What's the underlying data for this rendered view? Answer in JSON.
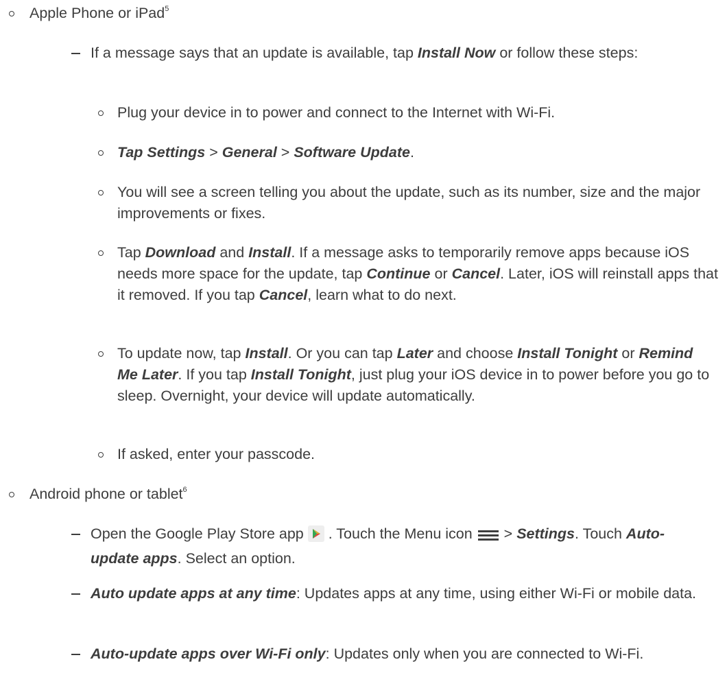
{
  "apple": {
    "heading": "Apple Phone or iPad",
    "footnote": "5",
    "intro": {
      "t1": "If a message says that an update is available, tap ",
      "b1": "Install Now",
      "t2": " or follow these steps:"
    },
    "steps": {
      "s1": "Plug your device in to power and connect to the Internet with Wi-Fi.",
      "s2": {
        "b1": "Tap Settings",
        "t1": " > ",
        "b2": "General",
        "t2": " > ",
        "b3": "Software Update",
        "t3": "."
      },
      "s3": "You will see a screen telling you about the update, such as its number, size and the major improvements or fixes.",
      "s4": {
        "t1": "Tap ",
        "b1": "Download",
        "t2": " and ",
        "b2": "Install",
        "t3": ". If a message asks to temporarily remove apps because iOS needs more space for the update, tap ",
        "b3": "Continue",
        "t4": " or ",
        "b4": "Cancel",
        "t5": ". Later, iOS will reinstall apps that it removed. If you tap ",
        "b5": "Cancel",
        "t6": ", learn what to do next."
      },
      "s5": {
        "t1": "To update now, tap ",
        "b1": "Install",
        "t2": ". Or you can tap ",
        "b2": "Later",
        "t3": " and choose ",
        "b3": "Install Tonight",
        "t4": " or ",
        "b4": "Remind Me Later",
        "t5": ". If you tap ",
        "b5": "Install Tonight",
        "t6": ", just plug your iOS device in to power before you go to sleep. Overnight, your device will update automatically."
      },
      "s6": "If asked, enter your passcode."
    }
  },
  "android": {
    "heading": "Android phone or tablet",
    "footnote": "6",
    "item1": {
      "t1": "Open the Google Play Store app ",
      "t2": " . Touch the Menu icon ",
      "t3": " > ",
      "b1": "Settings",
      "t4": ". Touch ",
      "b2": "Auto-update apps",
      "t5": ". Select an option."
    },
    "item2": {
      "b1": "Auto update apps at any time",
      "t1": ": Updates apps at any time, using either Wi-Fi or mobile data."
    },
    "item3": {
      "b1": "Auto-update apps over Wi-Fi only",
      "t1": ": Updates only when you are connected to Wi-Fi."
    }
  },
  "icons": {
    "bullet": "hollow-circle-bullet",
    "dash": "dash-bullet",
    "play_store": "play-store-icon",
    "menu": "hamburger-menu-icon"
  },
  "colors": {
    "text": "#3d3d3d",
    "play_green": "#34a853",
    "play_blue": "#4285f4",
    "play_red": "#ea4335",
    "play_yellow": "#fbbc04"
  }
}
